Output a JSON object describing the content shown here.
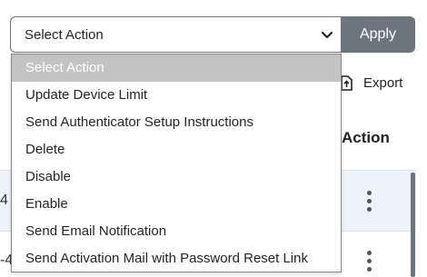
{
  "select": {
    "value": "Select Action"
  },
  "apply_label": "Apply",
  "dropdown": {
    "options": [
      "Select Action",
      "Update Device Limit",
      "Send Authenticator Setup Instructions",
      "Delete",
      "Disable",
      "Enable",
      "Send Email Notification",
      "Send Activation Mail with Password Reset Link"
    ],
    "selected_index": 0
  },
  "toolbar": {
    "export_label": "Export"
  },
  "table": {
    "action_header": "Action",
    "rows": [
      {
        "partial_text": "4"
      },
      {
        "partial_text": "-4"
      }
    ]
  },
  "icons": {
    "export": "export-icon",
    "chevron": "chevron-down-icon",
    "row_menu": "kebab-menu-icon"
  },
  "colors": {
    "apply_bg": "#6c757d",
    "selected_option_bg": "#c3c3c3",
    "highlight_row_bg": "#eef3fb"
  }
}
